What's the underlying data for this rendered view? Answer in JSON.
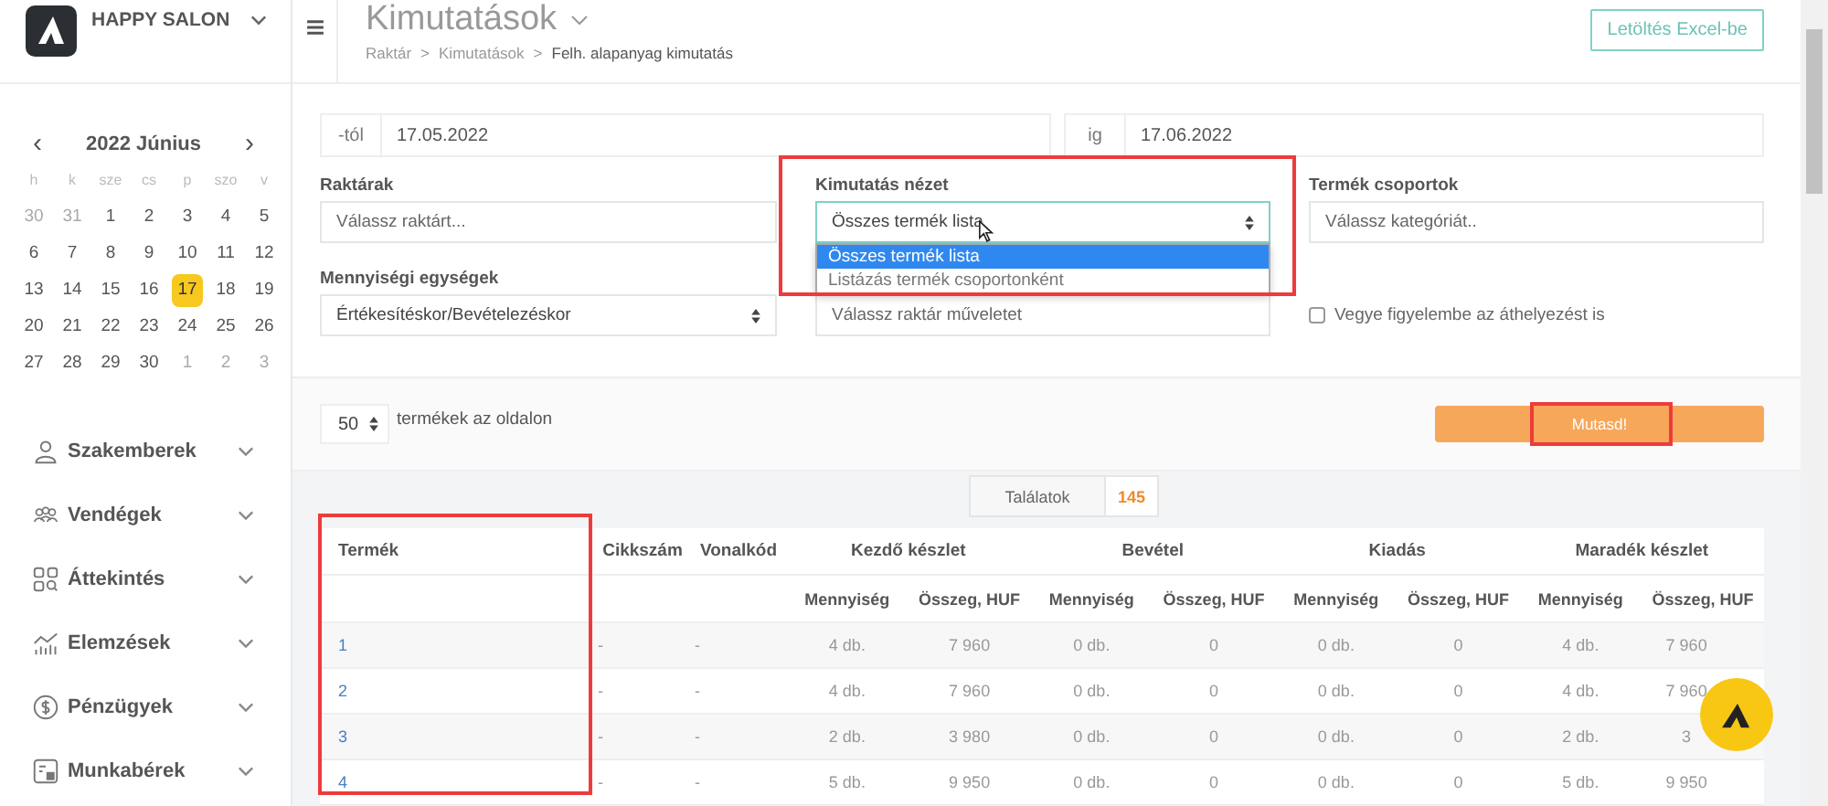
{
  "sidebar": {
    "brand": "HAPPY SALON",
    "calendar": {
      "prev": "‹",
      "month": "2022 Június",
      "next": "›",
      "weekdays": [
        "h",
        "k",
        "sze",
        "cs",
        "p",
        "szo",
        "v"
      ],
      "weeks": [
        [
          {
            "day": "30",
            "muted": true,
            "selected": false
          },
          {
            "day": "31",
            "muted": true,
            "selected": false
          },
          {
            "day": "1",
            "muted": false,
            "selected": false
          },
          {
            "day": "2",
            "muted": false,
            "selected": false
          },
          {
            "day": "3",
            "muted": false,
            "selected": false
          },
          {
            "day": "4",
            "muted": false,
            "selected": false
          },
          {
            "day": "5",
            "muted": false,
            "selected": false
          }
        ],
        [
          {
            "day": "6",
            "muted": false,
            "selected": false
          },
          {
            "day": "7",
            "muted": false,
            "selected": false
          },
          {
            "day": "8",
            "muted": false,
            "selected": false
          },
          {
            "day": "9",
            "muted": false,
            "selected": false
          },
          {
            "day": "10",
            "muted": false,
            "selected": false
          },
          {
            "day": "11",
            "muted": false,
            "selected": false
          },
          {
            "day": "12",
            "muted": false,
            "selected": false
          }
        ],
        [
          {
            "day": "13",
            "muted": false,
            "selected": false
          },
          {
            "day": "14",
            "muted": false,
            "selected": false
          },
          {
            "day": "15",
            "muted": false,
            "selected": false
          },
          {
            "day": "16",
            "muted": false,
            "selected": false
          },
          {
            "day": "17",
            "muted": false,
            "selected": true
          },
          {
            "day": "18",
            "muted": false,
            "selected": false
          },
          {
            "day": "19",
            "muted": false,
            "selected": false
          }
        ],
        [
          {
            "day": "20",
            "muted": false,
            "selected": false
          },
          {
            "day": "21",
            "muted": false,
            "selected": false
          },
          {
            "day": "22",
            "muted": false,
            "selected": false
          },
          {
            "day": "23",
            "muted": false,
            "selected": false
          },
          {
            "day": "24",
            "muted": false,
            "selected": false
          },
          {
            "day": "25",
            "muted": false,
            "selected": false
          },
          {
            "day": "26",
            "muted": false,
            "selected": false
          }
        ],
        [
          {
            "day": "27",
            "muted": false,
            "selected": false
          },
          {
            "day": "28",
            "muted": false,
            "selected": false
          },
          {
            "day": "29",
            "muted": false,
            "selected": false
          },
          {
            "day": "30",
            "muted": false,
            "selected": false
          },
          {
            "day": "1",
            "muted": true,
            "selected": false
          },
          {
            "day": "2",
            "muted": true,
            "selected": false
          },
          {
            "day": "3",
            "muted": true,
            "selected": false
          }
        ]
      ]
    },
    "nav": [
      {
        "label": "Szakemberek"
      },
      {
        "label": "Vendégek"
      },
      {
        "label": "Áttekintés"
      },
      {
        "label": "Elemzések"
      },
      {
        "label": "Pénzügyek"
      },
      {
        "label": "Munkabérek"
      }
    ]
  },
  "header": {
    "title": "Kimutatások",
    "breadcrumb": [
      "Raktár",
      "Kimutatások",
      "Felh. alapanyag kimutatás"
    ],
    "separator": ">",
    "export_button": "Letöltés Excel-be"
  },
  "filters": {
    "from": {
      "addon": "-tól",
      "value": "17.05.2022"
    },
    "to": {
      "addon": "ig",
      "value": "17.06.2022"
    },
    "fields": [
      {
        "kind": "input",
        "label": "Raktárak",
        "placeholder": "Válassz raktárt..."
      },
      {
        "kind": "select",
        "label": "Kimutatás nézet",
        "value": "Összes termék lista",
        "highlighted": true,
        "options": [
          {
            "label": "Összes termék lista",
            "selected": true
          },
          {
            "label": "Listázás termék csoportonként",
            "selected": false
          }
        ]
      },
      {
        "kind": "input",
        "label": "Termék csoportok",
        "placeholder": "Válassz kategóriát.."
      },
      {
        "kind": "select",
        "label": "Mennyiségi egységek",
        "value": "Értékesítéskor/Bevételezéskor"
      },
      {
        "kind": "input",
        "placeholder": "Válassz raktár műveletet"
      },
      {
        "kind": "checkbox",
        "label": "Vegye figyelembe az áthelyezést is",
        "checked": false
      }
    ]
  },
  "page_size": {
    "value": "50",
    "label": "termékek az oldalon"
  },
  "show_button": {
    "label": "Mutasd!",
    "highlighted": true
  },
  "results": {
    "label": "Találatok",
    "count": "145"
  },
  "table": {
    "groups": [
      {
        "label": "Termék",
        "highlighted": true
      },
      {
        "label": "Cikkszám"
      },
      {
        "label": "Vonalkód"
      },
      {
        "label": "Kezdő készlet"
      },
      {
        "label": "Bevétel"
      },
      {
        "label": "Kiadás"
      },
      {
        "label": "Maradék készlet"
      }
    ],
    "subcolumns": [
      "Mennyiség",
      "Összeg, HUF",
      "Mennyiség",
      "Összeg, HUF",
      "Mennyiség",
      "Összeg, HUF",
      "Mennyiség",
      "Összeg, HUF"
    ],
    "rows": [
      [
        "1",
        "-",
        "-",
        "4 db.",
        "7 960",
        "0 db.",
        "0",
        "0 db.",
        "0",
        "4 db.",
        "7 960"
      ],
      [
        "2",
        "-",
        "-",
        "4 db.",
        "7 960",
        "0 db.",
        "0",
        "0 db.",
        "0",
        "4 db.",
        "7 960"
      ],
      [
        "3",
        "-",
        "-",
        "2 db.",
        "3 980",
        "0 db.",
        "0",
        "0 db.",
        "0",
        "2 db.",
        "3"
      ],
      [
        "4",
        "-",
        "-",
        "5 db.",
        "9 950",
        "0 db.",
        "0",
        "0 db.",
        "0",
        "5 db.",
        "9 950"
      ]
    ]
  }
}
